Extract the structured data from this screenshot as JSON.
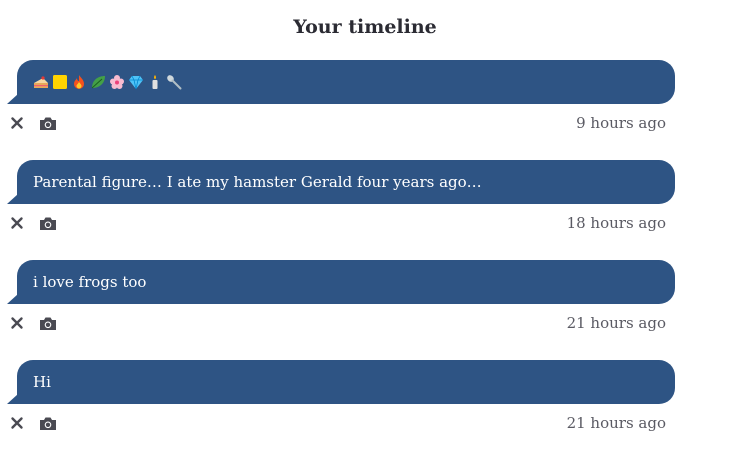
{
  "page": {
    "title": "Your timeline"
  },
  "colors": {
    "bubble_bg": "#2e5484",
    "bubble_text": "#ffffff",
    "icon": "#4a4a52",
    "timestamp": "#5a5a63"
  },
  "entries": [
    {
      "text": "🍰🟨🔥🍃🌸💎🕯🥄",
      "emoji_names": [
        "cake",
        "yellow-square",
        "fire",
        "leaf",
        "flower",
        "gem",
        "candle",
        "spoon"
      ],
      "timestamp": "9 hours ago"
    },
    {
      "text": "Parental figure… I ate my hamster Gerald four years ago…",
      "timestamp": "18 hours ago"
    },
    {
      "text": "i love frogs too",
      "timestamp": "21 hours ago"
    },
    {
      "text": "Hi",
      "timestamp": "21 hours ago"
    }
  ],
  "icons": {
    "delete": "close-icon",
    "photo": "camera-icon"
  }
}
